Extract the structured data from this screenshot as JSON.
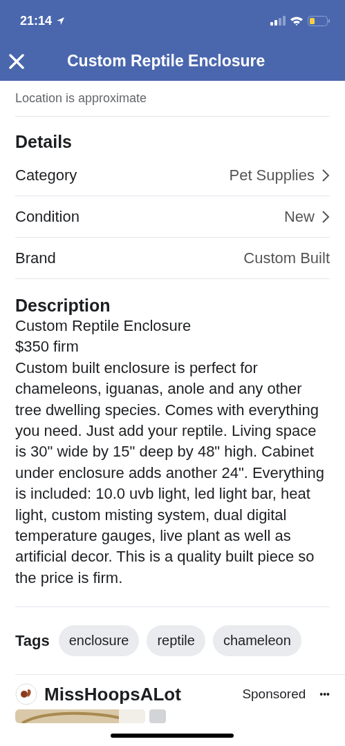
{
  "status_bar": {
    "time": "21:14"
  },
  "header": {
    "title": "Custom Reptile Enclosure"
  },
  "location": {
    "note": "Location is approximate"
  },
  "details": {
    "title": "Details",
    "rows": [
      {
        "label": "Category",
        "value": "Pet Supplies",
        "link": true
      },
      {
        "label": "Condition",
        "value": "New",
        "link": true
      },
      {
        "label": "Brand",
        "value": "Custom Built",
        "link": false
      }
    ]
  },
  "description": {
    "title": "Description",
    "lines": [
      "Custom Reptile Enclosure",
      "$350 firm",
      "Custom built enclosure is perfect for chameleons, iguanas, anole and any other tree dwelling species. Comes with everything you need. Just add your reptile. Living space is 30\" wide by 15\" deep by 48\" high. Cabinet under enclosure adds another 24\".  Everything is included: 10.0 uvb light, led light bar, heat light, custom misting system, dual digital temperature gauges, live plant as well as artificial decor.  This is a quality built piece so the price is firm."
    ]
  },
  "tags": {
    "title": "Tags",
    "items": [
      "enclosure",
      "reptile",
      "chameleon"
    ]
  },
  "ad": {
    "name": "MissHoopsALot",
    "label": "Sponsored",
    "more": "•••"
  }
}
